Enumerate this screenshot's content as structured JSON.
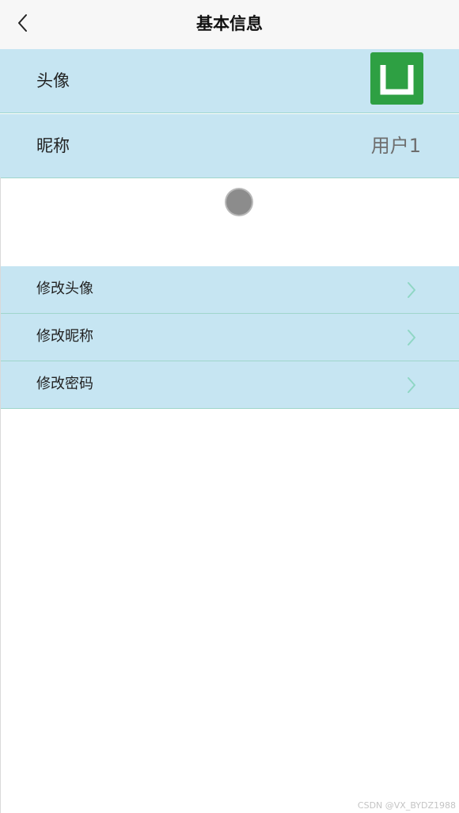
{
  "header": {
    "title": "基本信息"
  },
  "profile": {
    "avatar_label": "头像",
    "avatar_letter": "U",
    "nickname_label": "昵称",
    "nickname_value": "用户1"
  },
  "menu": {
    "items": [
      {
        "label": "修改头像"
      },
      {
        "label": "修改昵称"
      },
      {
        "label": "修改密码"
      }
    ]
  },
  "watermark": "CSDN @VX_BYDZ1988",
  "colors": {
    "row_bg": "#c6e5f2",
    "divider": "#9fd6cb",
    "avatar_bg": "#2ea043",
    "chevron": "#8fd6c4"
  }
}
